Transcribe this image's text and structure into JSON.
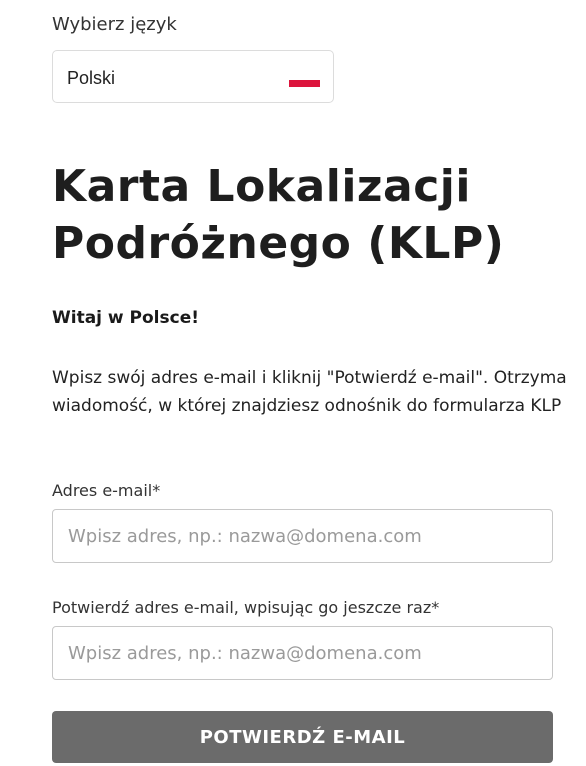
{
  "language": {
    "label": "Wybierz język",
    "selected": "Polski",
    "flag_icon": "poland-flag-icon",
    "flag_colors": [
      "#ffffff",
      "#dc143c"
    ]
  },
  "heading": {
    "line1": "Karta Lokalizacji",
    "line2": "Podróżnego (KLP)"
  },
  "welcome": "Witaj w Polsce!",
  "intro": {
    "line1": "Wpisz swój adres e-mail i kliknij \"Potwierdź e-mail\". Otrzyma",
    "line2": "wiadomość, w której znajdziesz odnośnik do formularza KLP"
  },
  "form": {
    "email": {
      "label": "Adres e-mail*",
      "placeholder": "Wpisz adres, np.: nazwa@domena.com",
      "value": ""
    },
    "email_confirm": {
      "label": "Potwierdź adres e-mail, wpisując go jeszcze raz*",
      "placeholder": "Wpisz adres, np.: nazwa@domena.com",
      "value": ""
    },
    "submit_label": "POTWIERDŹ E-MAIL"
  },
  "colors": {
    "button_bg": "#6b6b6b",
    "text": "#1a1a1a"
  }
}
